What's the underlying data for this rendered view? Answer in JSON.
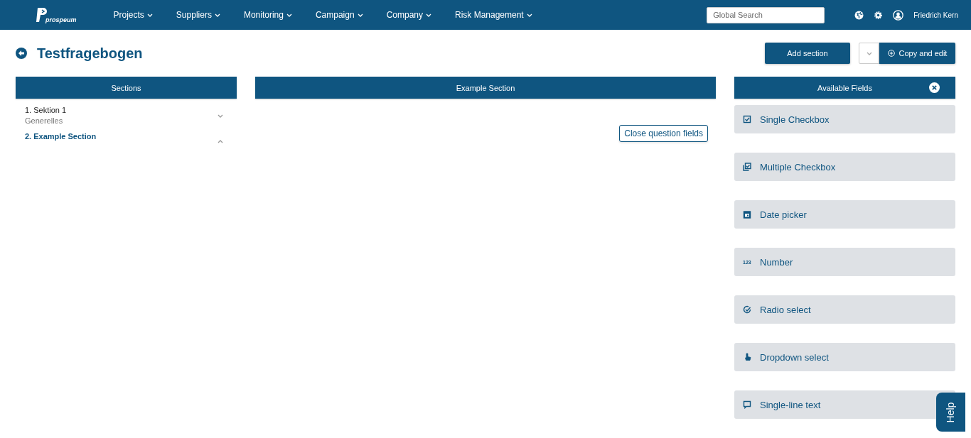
{
  "nav": {
    "logo": "prospeum",
    "menu": [
      {
        "label": "Projects"
      },
      {
        "label": "Suppliers"
      },
      {
        "label": "Monitoring"
      },
      {
        "label": "Campaign"
      },
      {
        "label": "Company"
      },
      {
        "label": "Risk Management"
      }
    ],
    "search": {
      "placeholder": "Global Search"
    },
    "user": "Friedrich Kern"
  },
  "page": {
    "title": "Testfragebogen",
    "add_section": "Add section",
    "copy_edit": "Copy and edit"
  },
  "sections": {
    "title": "Sections",
    "items": [
      {
        "label": "1. Sektion 1",
        "subtitle": "Generelles",
        "selected": false,
        "expanded": false
      },
      {
        "label": "2. Example Section",
        "selected": true,
        "expanded": true
      }
    ]
  },
  "editor": {
    "title": "Example Section",
    "close_button": "Close question fields"
  },
  "available_fields": {
    "title": "Available Fields",
    "items": [
      {
        "kind": "checkbox",
        "label": "Single Checkbox"
      },
      {
        "kind": "multi",
        "label": "Multiple Checkbox"
      },
      {
        "kind": "date",
        "label": "Date picker"
      },
      {
        "kind": "number",
        "label": "Number",
        "icon_text": "123"
      },
      {
        "kind": "radio",
        "label": "Radio select"
      },
      {
        "kind": "dropdown",
        "label": "Dropdown select"
      },
      {
        "kind": "text",
        "label": "Single-line text"
      }
    ]
  },
  "help": "Help"
}
